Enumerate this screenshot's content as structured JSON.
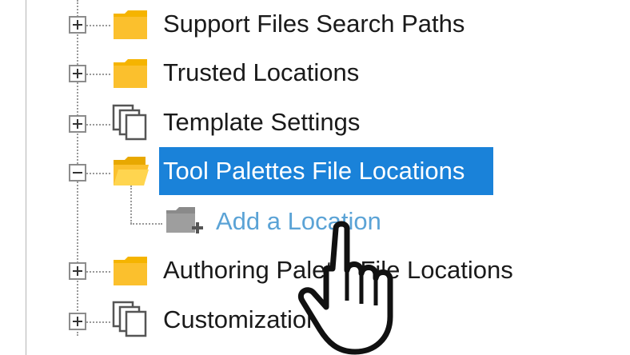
{
  "tree": {
    "items": [
      {
        "label": "Support Files Search Paths",
        "icon": "folder-icon",
        "state": "collapsed"
      },
      {
        "label": "Trusted Locations",
        "icon": "folder-icon",
        "state": "collapsed"
      },
      {
        "label": "Template Settings",
        "icon": "copy-stack-icon",
        "state": "collapsed"
      },
      {
        "label": "Tool Palettes File Locations",
        "icon": "folder-open-icon",
        "state": "expanded",
        "selected": true
      },
      {
        "label": "Add a Location",
        "icon": "add-folder-icon",
        "child": true
      },
      {
        "label": "Authoring Palette File Locations",
        "icon": "folder-icon",
        "state": "collapsed"
      },
      {
        "label": "Customization Files",
        "icon": "copy-stack-icon",
        "state": "collapsed"
      }
    ]
  },
  "colors": {
    "selection": "#1a82d9",
    "folder": "#f5b400",
    "link": "#5ba3d6"
  },
  "cursor_icon": "hand-pointer-icon"
}
